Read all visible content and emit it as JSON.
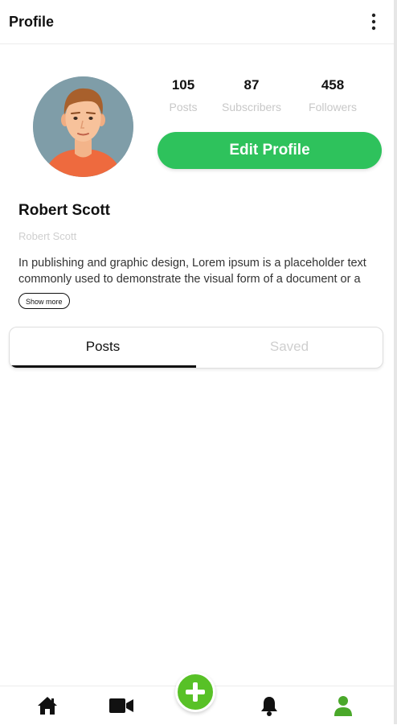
{
  "header": {
    "title": "Profile",
    "menu_icon": "more-vertical-icon"
  },
  "profile": {
    "avatar_icon": "avatar-illustration",
    "stats": [
      {
        "value": "105",
        "label": "Posts"
      },
      {
        "value": "87",
        "label": "Subscribers"
      },
      {
        "value": "458",
        "label": "Followers"
      }
    ],
    "edit_label": "Edit Profile",
    "name": "Robert Scott",
    "username": "Robert Scott",
    "bio": "In publishing and graphic design, Lorem ipsum is a placeholder text commonly used to demonstrate the visual form of a document or a typeface without relying on meaningful content.",
    "show_more_label": "Show more"
  },
  "tabs": [
    {
      "label": "Posts",
      "active": true
    },
    {
      "label": "Saved",
      "active": false
    }
  ],
  "nav": {
    "items": [
      {
        "icon": "home-icon"
      },
      {
        "icon": "video-icon"
      },
      {
        "icon": "add-icon"
      },
      {
        "icon": "bell-icon"
      },
      {
        "icon": "user-icon"
      }
    ],
    "active_index": 4
  },
  "colors": {
    "accent": "#2ec25c",
    "nav_active": "#4aa82a",
    "add_button": "#58c127"
  }
}
